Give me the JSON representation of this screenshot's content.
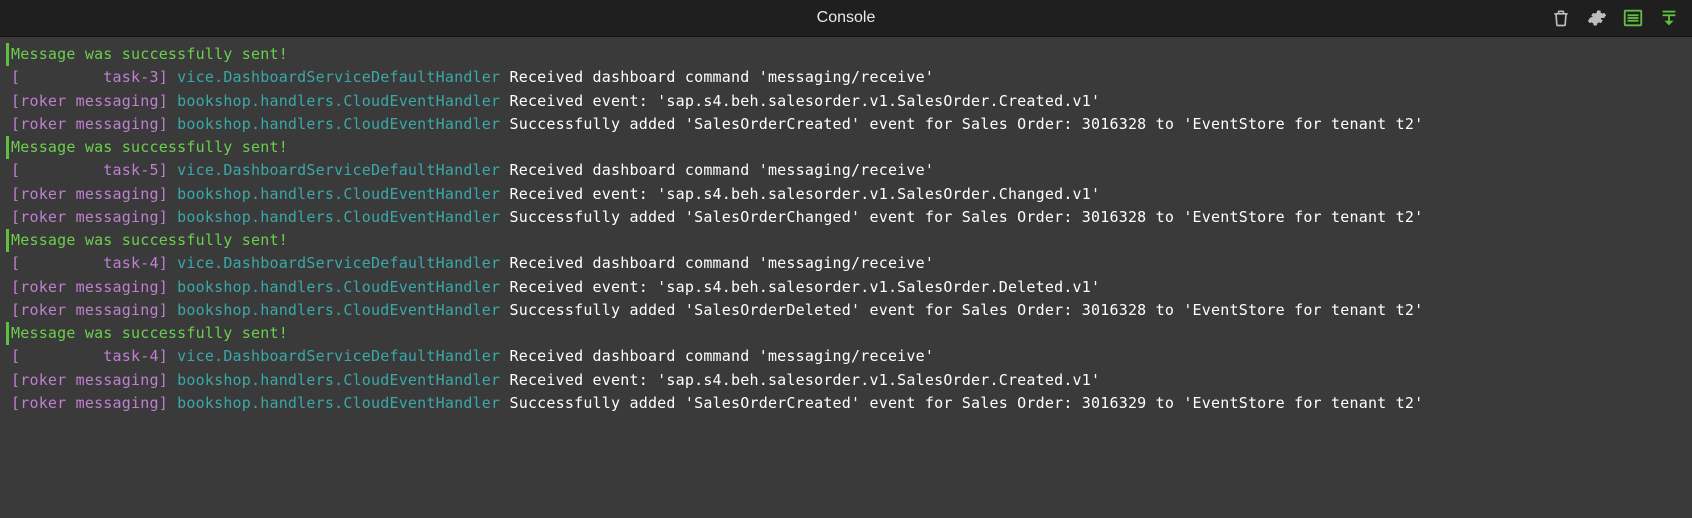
{
  "header": {
    "title": "Console"
  },
  "log": {
    "lines": [
      {
        "kind": "status",
        "segments": [
          {
            "cls": "c-green",
            "text": "Message was successfully sent!"
          }
        ]
      },
      {
        "kind": "plain",
        "segments": [
          {
            "cls": "c-bracket",
            "text": "[         task-3]"
          },
          {
            "cls": "c-teal",
            "text": " vice.DashboardServiceDefaultHandler"
          },
          {
            "cls": "c-white",
            "text": " Received dashboard command 'messaging/receive'"
          }
        ]
      },
      {
        "kind": "plain",
        "segments": [
          {
            "cls": "c-bracket",
            "text": "[roker messaging]"
          },
          {
            "cls": "c-teal",
            "text": " bookshop.handlers.CloudEventHandler"
          },
          {
            "cls": "c-white",
            "text": " Received event: 'sap.s4.beh.salesorder.v1.SalesOrder.Created.v1'"
          }
        ]
      },
      {
        "kind": "plain",
        "segments": [
          {
            "cls": "c-bracket",
            "text": "[roker messaging]"
          },
          {
            "cls": "c-teal",
            "text": " bookshop.handlers.CloudEventHandler"
          },
          {
            "cls": "c-white",
            "text": " Successfully added 'SalesOrderCreated' event for Sales Order: 3016328 to 'EventStore for tenant t2'"
          }
        ]
      },
      {
        "kind": "status",
        "segments": [
          {
            "cls": "c-green",
            "text": "Message was successfully sent!"
          }
        ]
      },
      {
        "kind": "plain",
        "segments": [
          {
            "cls": "c-bracket",
            "text": "[         task-5]"
          },
          {
            "cls": "c-teal",
            "text": " vice.DashboardServiceDefaultHandler"
          },
          {
            "cls": "c-white",
            "text": " Received dashboard command 'messaging/receive'"
          }
        ]
      },
      {
        "kind": "plain",
        "segments": [
          {
            "cls": "c-bracket",
            "text": "[roker messaging]"
          },
          {
            "cls": "c-teal",
            "text": " bookshop.handlers.CloudEventHandler"
          },
          {
            "cls": "c-white",
            "text": " Received event: 'sap.s4.beh.salesorder.v1.SalesOrder.Changed.v1'"
          }
        ]
      },
      {
        "kind": "plain",
        "segments": [
          {
            "cls": "c-bracket",
            "text": "[roker messaging]"
          },
          {
            "cls": "c-teal",
            "text": " bookshop.handlers.CloudEventHandler"
          },
          {
            "cls": "c-white",
            "text": " Successfully added 'SalesOrderChanged' event for Sales Order: 3016328 to 'EventStore for tenant t2'"
          }
        ]
      },
      {
        "kind": "status",
        "segments": [
          {
            "cls": "c-green",
            "text": "Message was successfully sent!"
          }
        ]
      },
      {
        "kind": "plain",
        "segments": [
          {
            "cls": "c-bracket",
            "text": "[         task-4]"
          },
          {
            "cls": "c-teal",
            "text": " vice.DashboardServiceDefaultHandler"
          },
          {
            "cls": "c-white",
            "text": " Received dashboard command 'messaging/receive'"
          }
        ]
      },
      {
        "kind": "plain",
        "segments": [
          {
            "cls": "c-bracket",
            "text": "[roker messaging]"
          },
          {
            "cls": "c-teal",
            "text": " bookshop.handlers.CloudEventHandler"
          },
          {
            "cls": "c-white",
            "text": " Received event: 'sap.s4.beh.salesorder.v1.SalesOrder.Deleted.v1'"
          }
        ]
      },
      {
        "kind": "plain",
        "segments": [
          {
            "cls": "c-bracket",
            "text": "[roker messaging]"
          },
          {
            "cls": "c-teal",
            "text": " bookshop.handlers.CloudEventHandler"
          },
          {
            "cls": "c-white",
            "text": " Successfully added 'SalesOrderDeleted' event for Sales Order: 3016328 to 'EventStore for tenant t2'"
          }
        ]
      },
      {
        "kind": "status",
        "segments": [
          {
            "cls": "c-green",
            "text": "Message was successfully sent!"
          }
        ]
      },
      {
        "kind": "plain",
        "segments": [
          {
            "cls": "c-bracket",
            "text": "[         task-4]"
          },
          {
            "cls": "c-teal",
            "text": " vice.DashboardServiceDefaultHandler"
          },
          {
            "cls": "c-white",
            "text": " Received dashboard command 'messaging/receive'"
          }
        ]
      },
      {
        "kind": "plain",
        "segments": [
          {
            "cls": "c-bracket",
            "text": "[roker messaging]"
          },
          {
            "cls": "c-teal",
            "text": " bookshop.handlers.CloudEventHandler"
          },
          {
            "cls": "c-white",
            "text": " Received event: 'sap.s4.beh.salesorder.v1.SalesOrder.Created.v1'"
          }
        ]
      },
      {
        "kind": "plain",
        "segments": [
          {
            "cls": "c-bracket",
            "text": "[roker messaging]"
          },
          {
            "cls": "c-teal",
            "text": " bookshop.handlers.CloudEventHandler"
          },
          {
            "cls": "c-white",
            "text": " Successfully added 'SalesOrderCreated' event for Sales Order: 3016329 to 'EventStore for tenant t2'"
          }
        ]
      }
    ]
  }
}
